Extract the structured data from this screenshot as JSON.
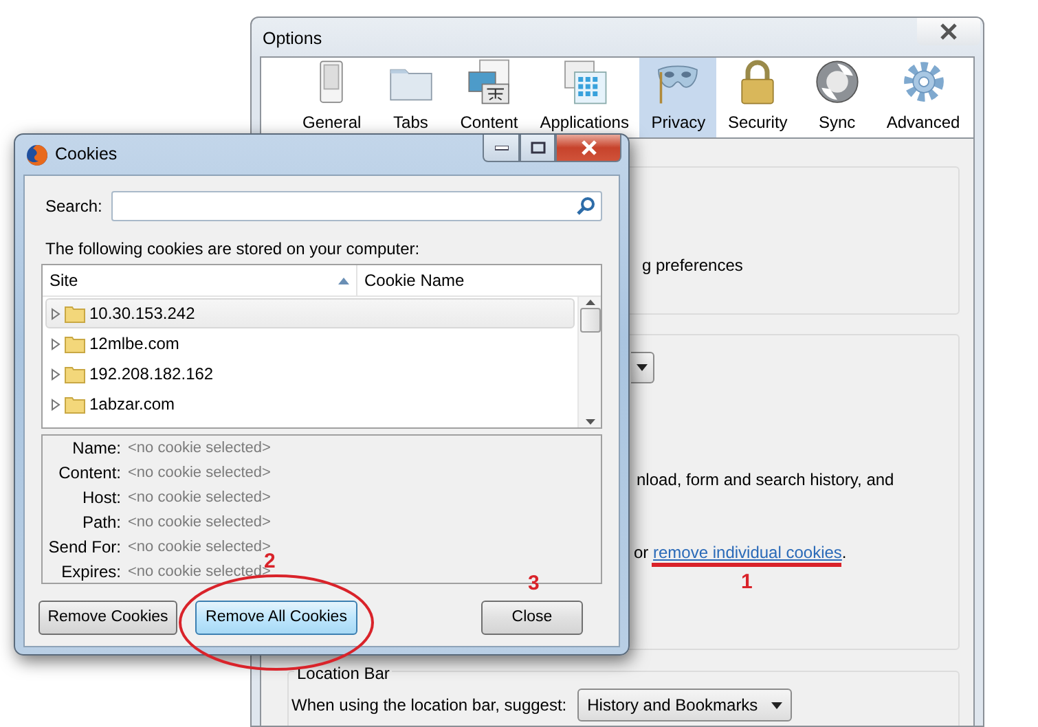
{
  "options_window": {
    "title": "Options",
    "tabs": [
      {
        "label": "General",
        "selected": false
      },
      {
        "label": "Tabs",
        "selected": false
      },
      {
        "label": "Content",
        "selected": false
      },
      {
        "label": "Applications",
        "selected": false
      },
      {
        "label": "Privacy",
        "selected": true
      },
      {
        "label": "Security",
        "selected": false
      },
      {
        "label": "Sync",
        "selected": false
      },
      {
        "label": "Advanced",
        "selected": false
      }
    ],
    "tracking_text": "g preferences",
    "history_text": "nload, form and search history, and",
    "cookies_line": {
      "prefix": "or",
      "link": "remove individual cookies",
      "suffix": "."
    },
    "location_bar": {
      "legend": "Location Bar",
      "label": "When using the location bar, suggest:",
      "value": "History and Bookmarks"
    }
  },
  "cookies_dialog": {
    "title": "Cookies",
    "search_label": "Search:",
    "intro": "The following cookies are stored on your computer:",
    "columns": [
      {
        "label": "Site",
        "sorted": true
      },
      {
        "label": "Cookie Name",
        "sorted": false
      }
    ],
    "rows": [
      {
        "site": "10.30.153.242",
        "selected": true
      },
      {
        "site": "12mlbe.com",
        "selected": false
      },
      {
        "site": "192.208.182.162",
        "selected": false
      },
      {
        "site": "1abzar.com",
        "selected": false
      }
    ],
    "details": [
      {
        "label": "Name:",
        "value": "<no cookie selected>"
      },
      {
        "label": "Content:",
        "value": "<no cookie selected>"
      },
      {
        "label": "Host:",
        "value": "<no cookie selected>"
      },
      {
        "label": "Path:",
        "value": "<no cookie selected>"
      },
      {
        "label": "Send For:",
        "value": "<no cookie selected>"
      },
      {
        "label": "Expires:",
        "value": "<no cookie selected>"
      }
    ],
    "buttons": [
      {
        "label": "Remove Cookies",
        "selected": false
      },
      {
        "label": "Remove All Cookies",
        "selected": true
      },
      {
        "label": "Close",
        "selected": false
      }
    ]
  },
  "annotations": [
    {
      "kind": "underline",
      "label": "1"
    },
    {
      "kind": "ellipse",
      "label": "2"
    },
    {
      "kind": "number",
      "label": "3"
    }
  ]
}
